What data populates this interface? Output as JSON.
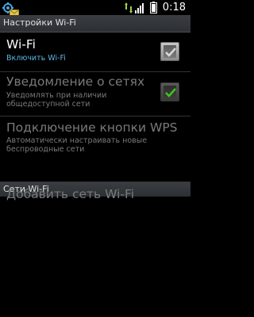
{
  "status_bar": {
    "time": "0:18",
    "icons": [
      "usb-icon",
      "envelope-icon",
      "transfer-icon",
      "signal-icon",
      "battery-icon"
    ]
  },
  "header": {
    "title": "Настройки Wi-Fi"
  },
  "items": [
    {
      "title": "Wi-Fi",
      "summary": "Включить Wi-Fi",
      "checked": true,
      "enabled": true
    },
    {
      "title": "Уведомление о сетях",
      "summary": "Уведомлять при наличии общедоступной сети",
      "checked": true,
      "enabled": false
    },
    {
      "title": "Подключение кнопки WPS",
      "summary": "Автоматически настраивать новые беспроводные сети",
      "enabled": false
    }
  ],
  "networks_section": {
    "title": "Сети Wi-Fi",
    "add_network_label": "Добавить сеть Wi-Fi"
  },
  "colors": {
    "accent_summary": "#5fb4e3",
    "disabled_text": "#7a7a7a",
    "check_green": "#3fc41c"
  }
}
